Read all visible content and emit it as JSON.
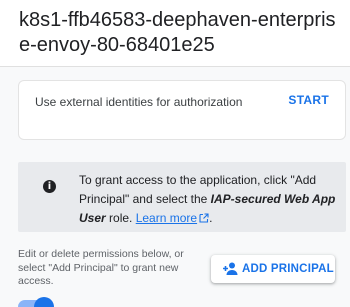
{
  "header": {
    "title": "k8s1-ffb46583-deephaven-enterprise-envoy-80-68401e25"
  },
  "iap_card": {
    "label": "Use external identities for authorization",
    "start_label": "START"
  },
  "info_box": {
    "icon": "info-icon",
    "text_part1": "To grant access to the application, click \"Add Principal\" and select the ",
    "role_name": "IAP-secured Web App User",
    "text_part2": " role. ",
    "link_label": "Learn more",
    "text_end": "."
  },
  "permissions": {
    "hint": "Edit or delete permissions below, or select \"Add Principal\" to grant new access.",
    "add_button_label": "ADD PRINCIPAL",
    "add_button_icon": "person-add-icon"
  },
  "toggle": {
    "state": "on"
  },
  "colors": {
    "accent": "#1a73e8",
    "info_bg": "#e8eaed",
    "panel_bg": "#f8f9fa"
  }
}
